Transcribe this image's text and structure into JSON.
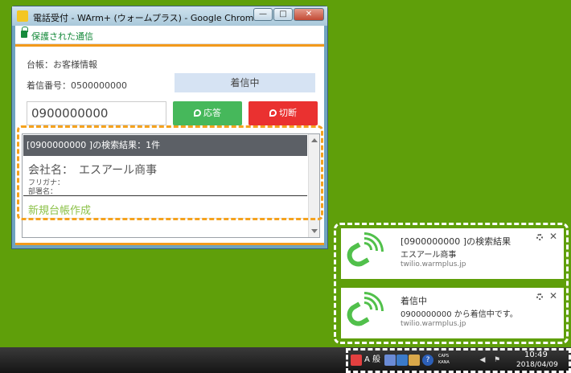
{
  "window": {
    "title": "電話受付 - WArm+ (ウォームプラス) - Google Chrome",
    "minimize": "—",
    "maximize": "□",
    "close": "✕"
  },
  "omnibar": {
    "secure_text": "保護された通信"
  },
  "call": {
    "ledger_label": "台帳：お客様情報",
    "caller_number_label": "着信番号：0500000000",
    "status": "着信中",
    "phone_value": "0900000000",
    "answer_label": "応答",
    "hangup_label": "切断"
  },
  "results": {
    "header": "[0900000000 ]の検索結果：1件",
    "company": "会社名：　エスアール商事",
    "furigana": "フリガナ：",
    "department": "部署名：",
    "new_ledger": "新規台帳作成"
  },
  "notifications": [
    {
      "title": "[0900000000 ]の検索結果",
      "body": "エスアール商事",
      "source": "twilio.warmplus.jp"
    },
    {
      "title": "着信中",
      "body": "0900000000 から着信中です。",
      "source": "twilio.warmplus.jp"
    }
  ],
  "taskbar": {
    "ime_label": "A 般",
    "caps": "CAPS",
    "kana": "KANA",
    "time": "10:49",
    "date": "2018/04/09"
  },
  "colors": {
    "accent_orange": "#f39a1b",
    "answer_green": "#46b85b",
    "hangup_red": "#ea3130",
    "desktop_green": "#5f9f0a"
  }
}
